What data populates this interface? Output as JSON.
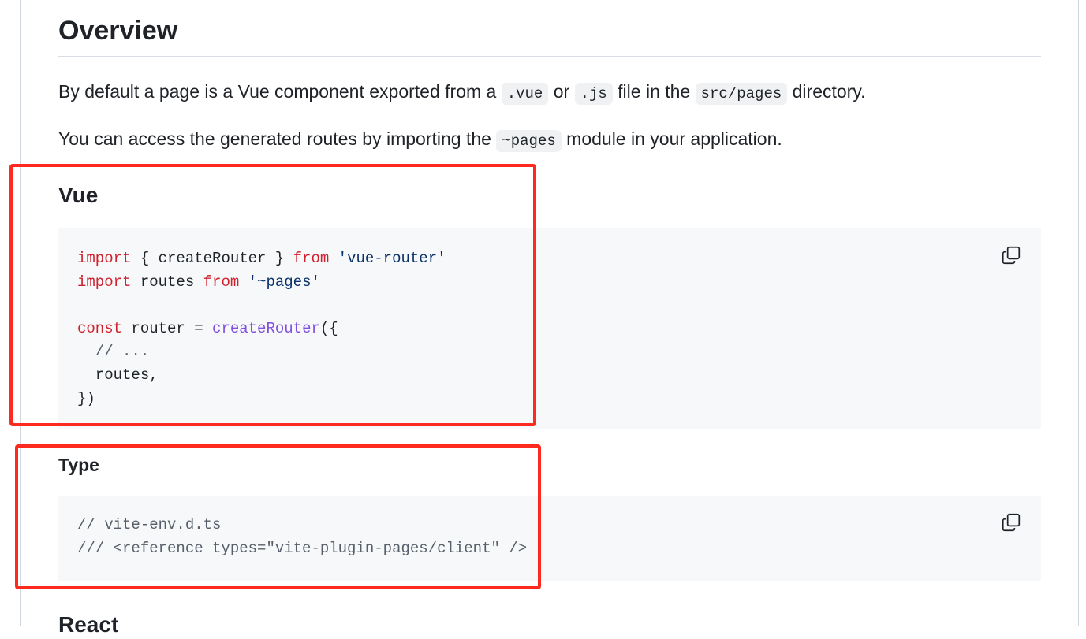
{
  "overview": {
    "title": "Overview",
    "para1": {
      "before": "By default a page is a Vue component exported from a",
      "code1": ".vue",
      "mid1": "or",
      "code2": ".js",
      "mid2": "file in the",
      "code3": "src/pages",
      "after": "directory."
    },
    "para2": {
      "before": "You can access the generated routes by importing the",
      "code": "~pages",
      "after": "module in your application."
    }
  },
  "vue_section": {
    "title": "Vue",
    "code": {
      "line1": {
        "kw1": "import",
        "t1": " { createRouter } ",
        "kw2": "from",
        "sp": " ",
        "str": "'vue-router'"
      },
      "line2": {
        "kw1": "import",
        "t1": " routes ",
        "kw2": "from",
        "sp": " ",
        "str": "'~pages'"
      },
      "line4": {
        "kw": "const",
        "t1": " router = ",
        "fn": "createRouter",
        "t2": "({"
      },
      "line5": "  // ...",
      "line6": "  routes,",
      "line7": "})"
    }
  },
  "type_section": {
    "title": "Type",
    "code": {
      "line1": "// vite-env.d.ts",
      "line2": "/// <reference types=\"vite-plugin-pages/client\" />"
    }
  },
  "react_section": {
    "title": "React"
  },
  "icons": {
    "copy": "copy-icon"
  },
  "colors": {
    "highlight": "#ff2a1f",
    "keyword": "#cf222e",
    "string": "#0a3069",
    "function": "#8250df",
    "comment": "#57606a",
    "code_bg": "#f6f8fa"
  }
}
